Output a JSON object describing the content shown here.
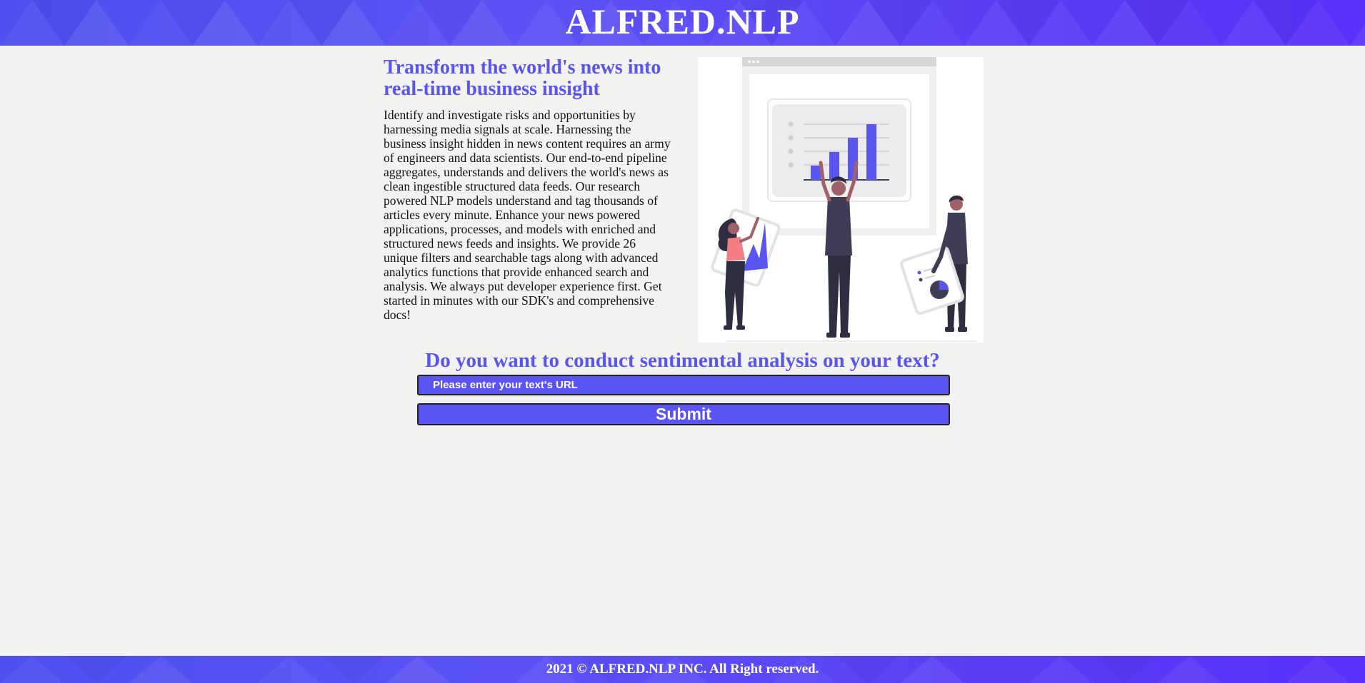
{
  "header": {
    "brand": "ALFRED.NLP"
  },
  "hero": {
    "title": "Transform the world's news into real-time business insight",
    "body": "Identify and investigate risks and opportunities by harnessing media signals at scale. Harnessing the business insight hidden in news content requires an army of engineers and data scientists. Our end-to-end pipeline aggregates, understands and delivers the world's news as clean ingestible structured data feeds. Our research powered NLP models understand and tag thousands of articles every minute. Enhance your news powered applications, processes, and models with enriched and structured news feeds and insights. We provide 26 unique filters and searchable tags along with advanced analytics functions that provide enhanced search and analysis. We always put developer experience first. Get started in minutes with our SDK's and comprehensive docs!"
  },
  "analysis": {
    "title": "Do you want to conduct sentimental analysis on your text?",
    "url_placeholder": "Please enter your text's URL",
    "url_value": "",
    "submit_label": "Submit"
  },
  "footer": {
    "copyright": "2021 © ALFRED.NLP INC. All Right reserved."
  },
  "colors": {
    "accent": "#5a55ee",
    "banner_start": "#4f4ff0",
    "banner_end": "#5a30fb",
    "page_background": "#f2f2f1",
    "figure_shirt_pink": "#f47c84",
    "figure_dark": "#2f2e41"
  },
  "icons": {
    "hero_illustration": "team-analyzing-bar-chart-illustration"
  }
}
